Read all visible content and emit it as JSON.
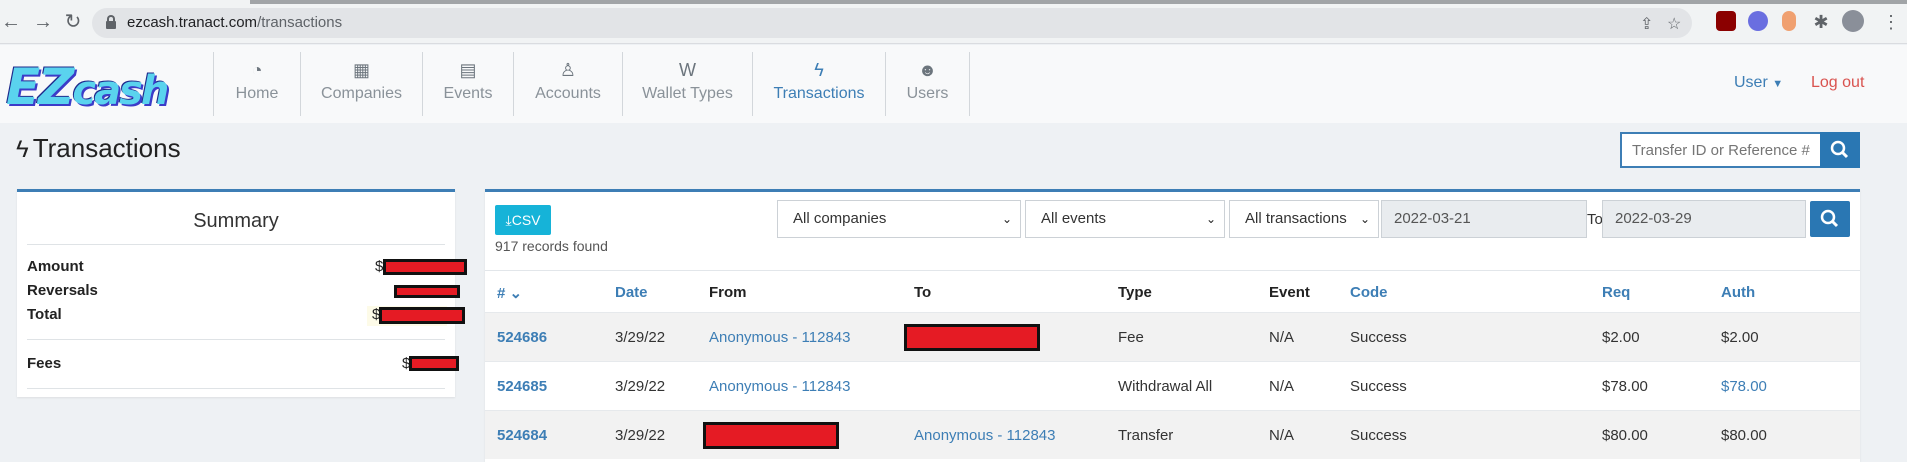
{
  "browser": {
    "url_host": "ezcash.tranact.com",
    "url_path": "/transactions"
  },
  "app": {
    "logo_main": "EZ",
    "logo_small": "cash",
    "nav": [
      {
        "label": "Home",
        "icon": "dashboard-icon"
      },
      {
        "label": "Companies",
        "icon": "building-icon"
      },
      {
        "label": "Events",
        "icon": "calendar-icon"
      },
      {
        "label": "Accounts",
        "icon": "person-icon"
      },
      {
        "label": "Wallet Types",
        "icon": "wallet-icon"
      },
      {
        "label": "Transactions",
        "icon": "bolt-icon",
        "active": true
      },
      {
        "label": "Users",
        "icon": "users-icon"
      }
    ],
    "user_menu": "User",
    "logout": "Log out",
    "accent_color": "#3d7eb5"
  },
  "page": {
    "title": "Transactions",
    "search_placeholder": "Transfer ID or Reference #"
  },
  "summary": {
    "title": "Summary",
    "rows": [
      {
        "label": "Amount",
        "prefix": "$"
      },
      {
        "label": "Reversals",
        "prefix": ""
      },
      {
        "label": "Total",
        "prefix": "$"
      },
      {
        "label": "Fees",
        "prefix": "$"
      }
    ]
  },
  "filters": {
    "csv_label": "CSV",
    "records_found": "917 records found",
    "company": "All companies",
    "event": "All events",
    "transaction_type": "All transactions",
    "date_from": "2022-03-21",
    "to_label": "To",
    "date_to": "2022-03-29"
  },
  "table": {
    "headers": {
      "id": "#",
      "date": "Date",
      "from": "From",
      "to": "To",
      "type": "Type",
      "event": "Event",
      "code": "Code",
      "req": "Req",
      "auth": "Auth"
    },
    "rows": [
      {
        "id": "524686",
        "date": "3/29/22",
        "from": "Anonymous - 112843",
        "to": "",
        "type": "Fee",
        "event": "N/A",
        "code": "Success",
        "req": "$2.00",
        "auth": "$2.00"
      },
      {
        "id": "524685",
        "date": "3/29/22",
        "from": "Anonymous - 112843",
        "to": "",
        "type": "Withdrawal All",
        "event": "N/A",
        "code": "Success",
        "req": "$78.00",
        "auth": "$78.00"
      },
      {
        "id": "524684",
        "date": "3/29/22",
        "from": "",
        "to": "Anonymous - 112843",
        "type": "Transfer",
        "event": "N/A",
        "code": "Success",
        "req": "$80.00",
        "auth": "$80.00"
      }
    ]
  }
}
